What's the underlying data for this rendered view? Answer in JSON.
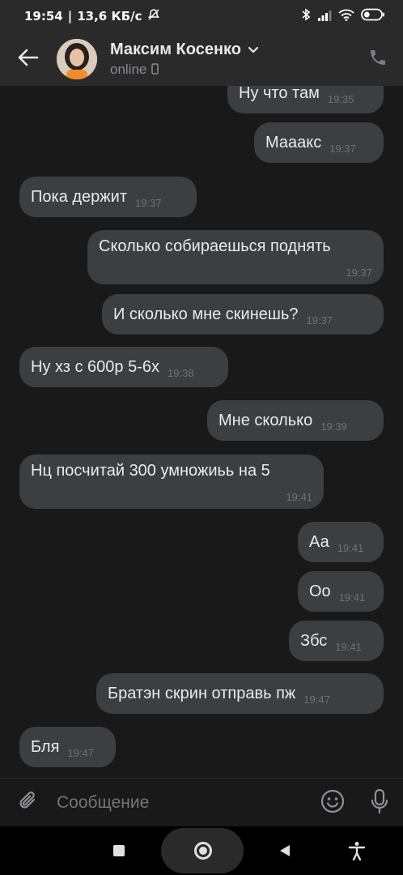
{
  "status_bar": {
    "time": "19:54",
    "speed": "13,6 КБ/с",
    "battery_level": 0.35
  },
  "header": {
    "name": "Максим Косенко",
    "status": "online"
  },
  "messages": [
    {
      "side": "out",
      "text": "Ну что там",
      "time": "19:35"
    },
    {
      "side": "out",
      "text": "Мааакс",
      "time": "19:37"
    },
    {
      "side": "in",
      "text": "Пока держит",
      "time": "19:37"
    },
    {
      "side": "out",
      "text": "Сколько собираешься поднять",
      "time": "19:37"
    },
    {
      "side": "out",
      "text": "И сколько мне скинешь?",
      "time": "19:37"
    },
    {
      "side": "in",
      "text": "Ну хз с 600р 5-6х",
      "time": "19:38"
    },
    {
      "side": "out",
      "text": "Мне сколько",
      "time": "19:39"
    },
    {
      "side": "in",
      "text": "Нц посчитай 300 умножиьь на 5",
      "time": "19:41"
    },
    {
      "side": "out",
      "text": "Аа",
      "time": "19:41"
    },
    {
      "side": "out",
      "text": "Оо",
      "time": "19:41"
    },
    {
      "side": "out",
      "text": "Збс",
      "time": "19:41"
    },
    {
      "side": "out",
      "text": "Братэн скрин отправь пж",
      "time": "19:47"
    },
    {
      "side": "in",
      "text": "Бля",
      "time": "19:47"
    }
  ],
  "composer": {
    "placeholder": "Сообщение"
  },
  "icons": {
    "back": "arrow-left-icon",
    "call": "phone-icon",
    "attach": "paperclip-icon",
    "emoji": "smiley-icon",
    "mic": "microphone-icon"
  },
  "colors": {
    "background": "#19191a",
    "bar": "#2a2a2b",
    "bubble": "#3d3e40",
    "text": "#e9eaec",
    "time": "#6f7176"
  }
}
